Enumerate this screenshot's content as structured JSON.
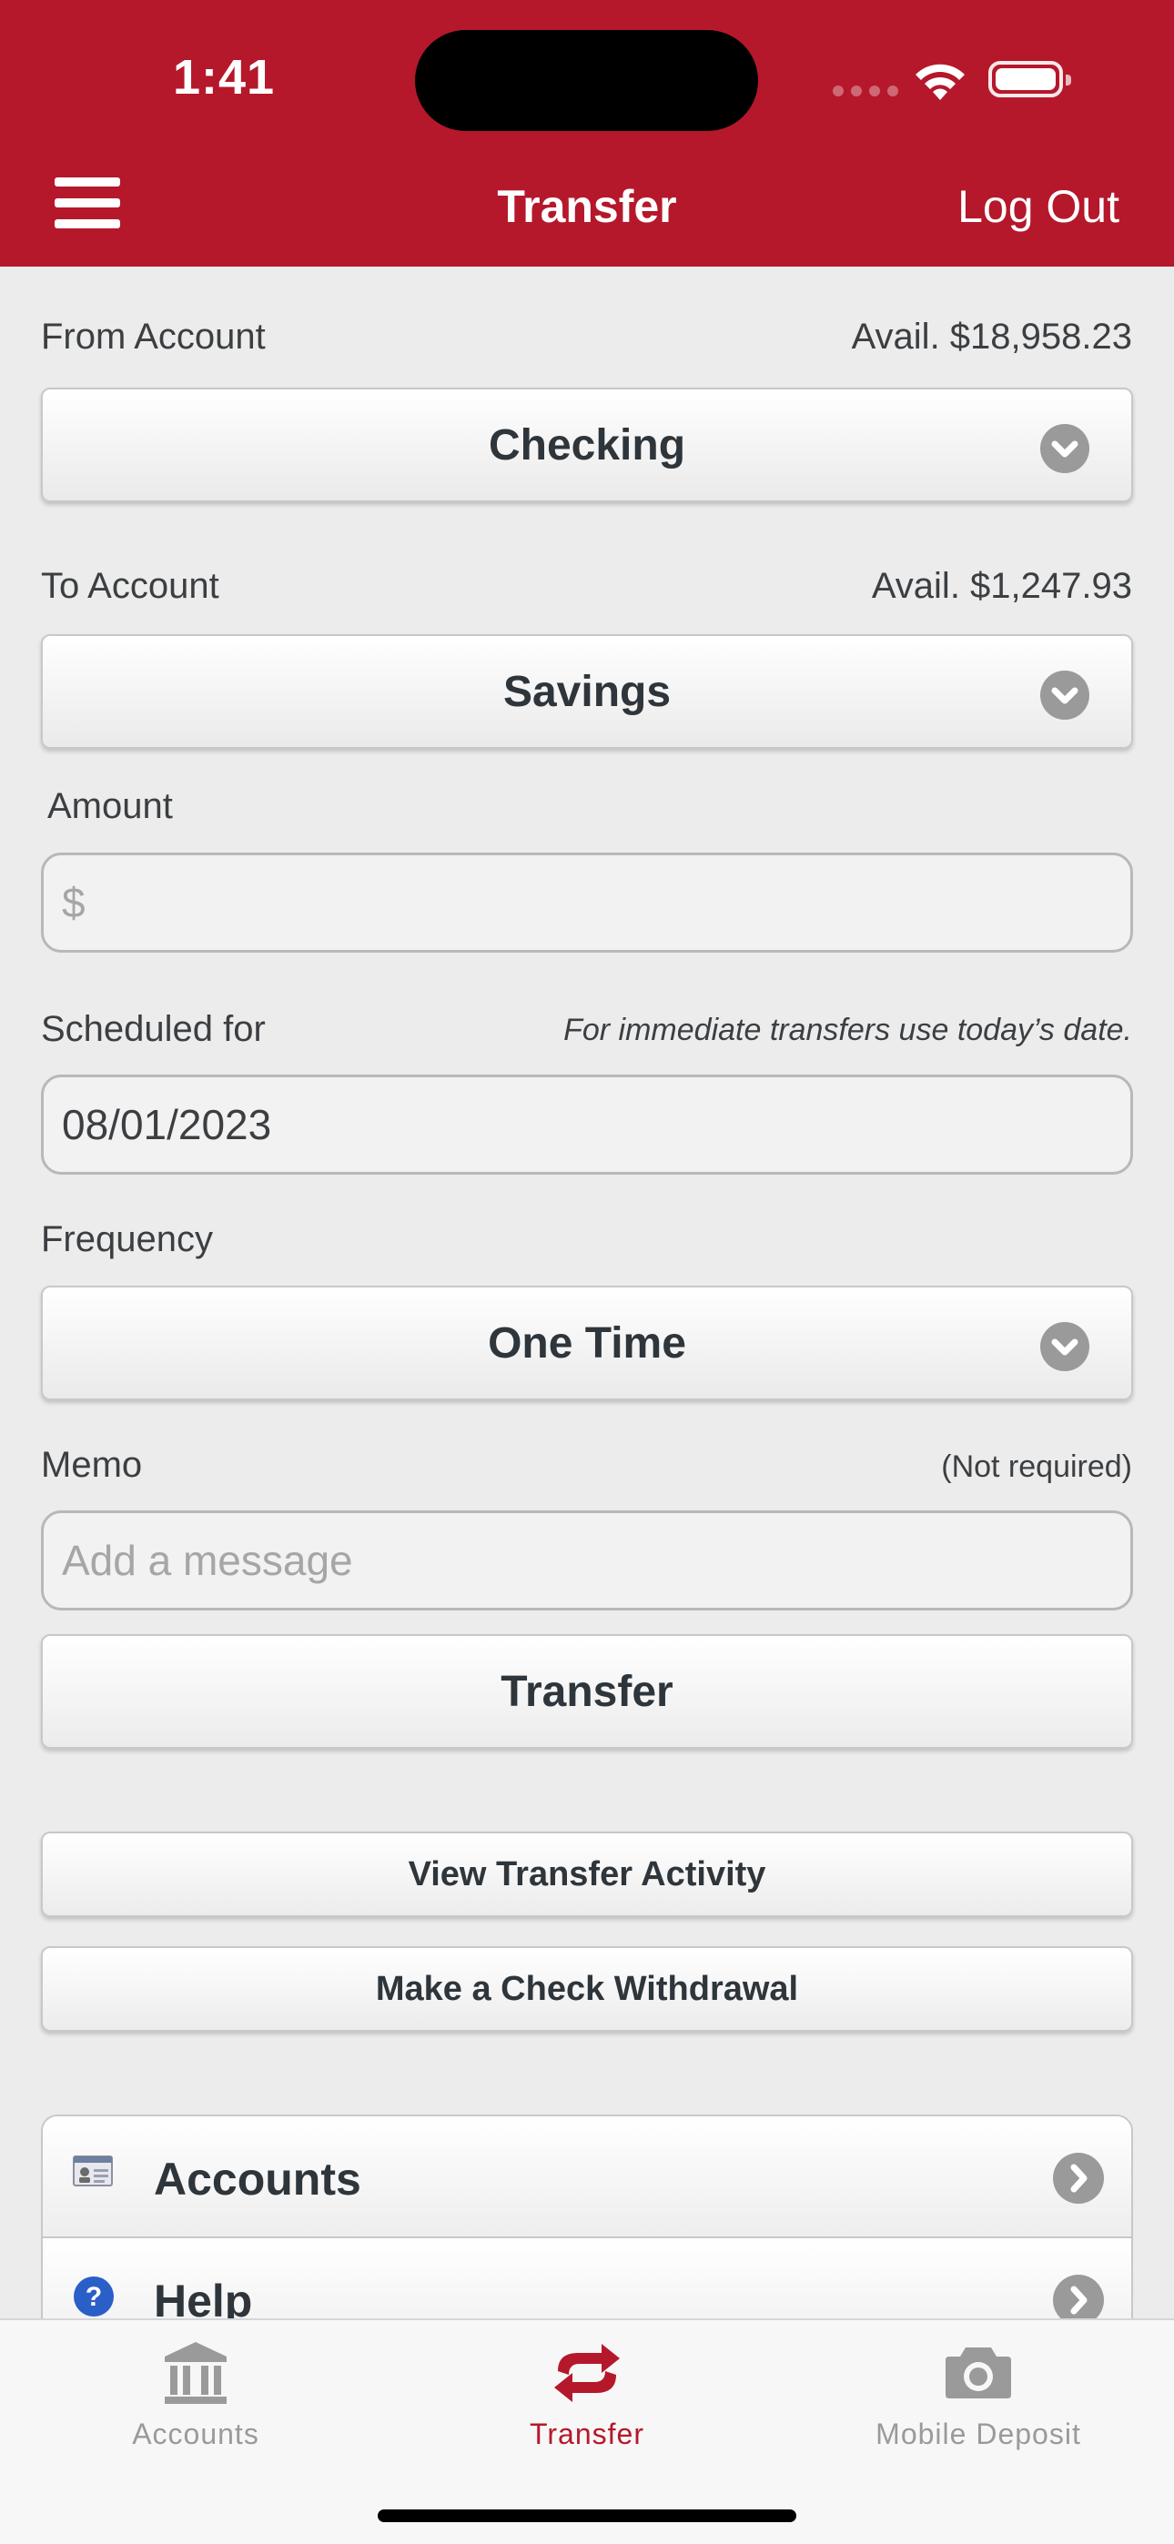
{
  "status_bar": {
    "time": "1:41"
  },
  "header": {
    "title": "Transfer",
    "logout_label": "Log Out"
  },
  "from_account": {
    "label": "From Account",
    "available": "Avail. $18,958.23",
    "selected": "Checking"
  },
  "to_account": {
    "label": "To Account",
    "available": "Avail. $1,247.93",
    "selected": "Savings"
  },
  "amount": {
    "label": "Amount",
    "placeholder": "$"
  },
  "scheduled": {
    "label": "Scheduled for",
    "hint": "For immediate transfers use today’s date.",
    "value": "08/01/2023"
  },
  "frequency": {
    "label": "Frequency",
    "selected": "One Time"
  },
  "memo": {
    "label": "Memo",
    "note": "(Not required)",
    "placeholder": "Add a message"
  },
  "transfer_button": "Transfer",
  "view_activity_button": "View Transfer Activity",
  "check_withdrawal_button": "Make a Check Withdrawal",
  "menu_items": [
    {
      "label": "Accounts",
      "icon": "account-card-icon"
    },
    {
      "label": "Help",
      "icon": "help-icon"
    }
  ],
  "tab_bar": {
    "active": "Transfer",
    "tabs": [
      {
        "label": "Accounts",
        "icon": "bank-icon"
      },
      {
        "label": "Transfer",
        "icon": "transfer-arrows-icon"
      },
      {
        "label": "Mobile Deposit",
        "icon": "camera-icon"
      }
    ]
  },
  "colors": {
    "brand": "#b5182b",
    "background": "#ececec",
    "muted": "#9a9a9a"
  }
}
